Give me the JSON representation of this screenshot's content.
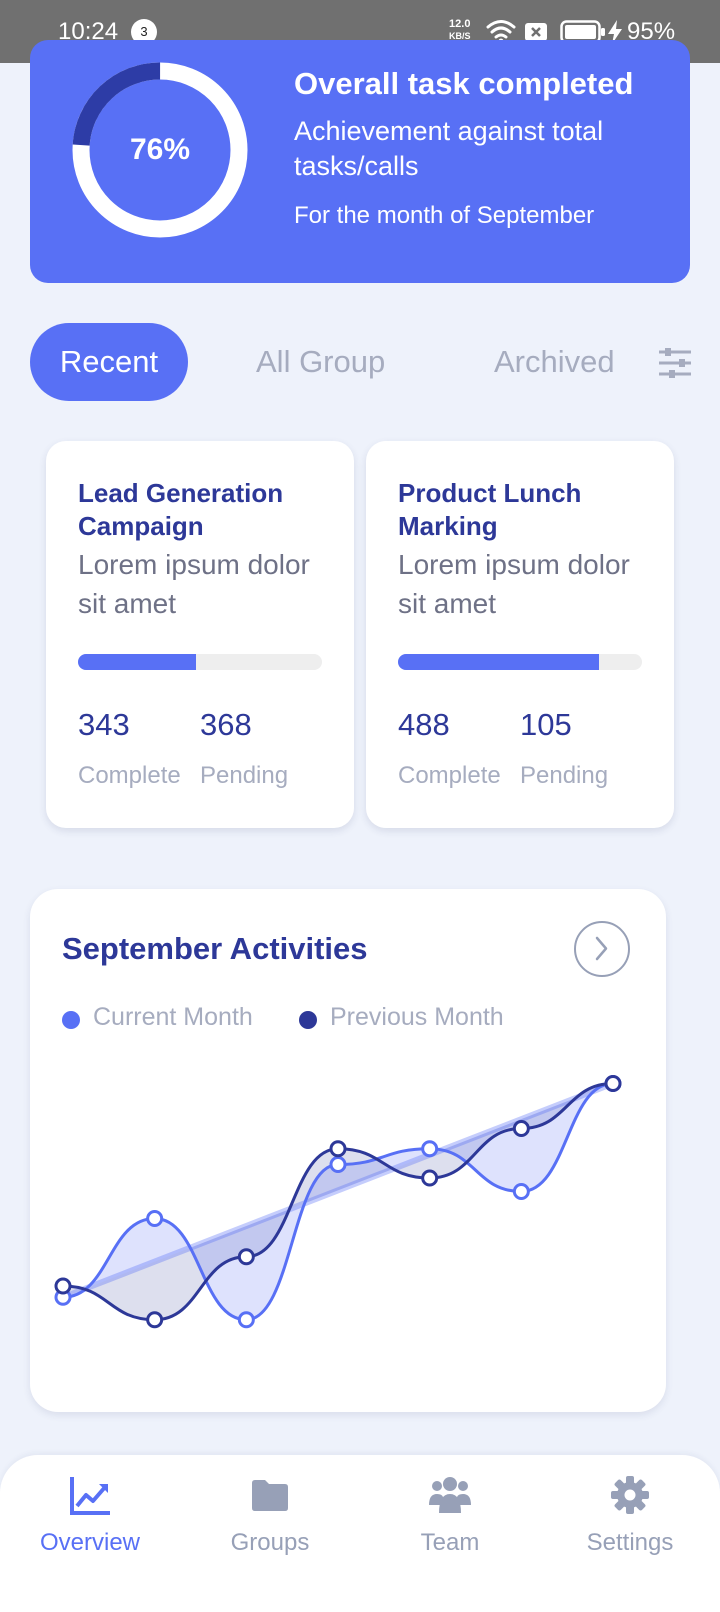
{
  "status_bar": {
    "time": "10:24",
    "notification_count": "3",
    "net_speed_value": "12.0",
    "net_speed_unit": "KB/S",
    "battery": "95%"
  },
  "summary": {
    "percent": "76%",
    "percent_value": 76,
    "title": "Overall task completed",
    "subtitle": "Achievement against total tasks/calls",
    "period": "For the month of September"
  },
  "tabs": {
    "recent": "Recent",
    "all_group": "All Group",
    "archived": "Archived"
  },
  "campaigns": [
    {
      "title": "Lead Generation Campaign",
      "description": "Lorem ipsum dolor sit amet",
      "progress": 0.485,
      "complete_value": "343",
      "pending_value": "368",
      "complete_label": "Complete",
      "pending_label": "Pending"
    },
    {
      "title": "Product Lunch Marking",
      "description": "Lorem ipsum dolor sit amet",
      "progress": 0.823,
      "complete_value": "488",
      "pending_value": "105",
      "complete_label": "Complete",
      "pending_label": "Pending"
    }
  ],
  "activities": {
    "title": "September Activities",
    "legend_current": "Current Month",
    "legend_previous": "Previous Month"
  },
  "colors": {
    "accent": "#5870f5",
    "navy": "#2d3898",
    "muted": "#a6acbf",
    "background": "#eef2fb"
  },
  "chart_data": {
    "type": "line",
    "x": [
      1,
      2,
      3,
      4,
      5,
      6,
      7
    ],
    "series": [
      {
        "name": "Current Month",
        "values": [
          0.5,
          4.0,
          -0.5,
          6.4,
          7.1,
          5.2,
          10
        ]
      },
      {
        "name": "Previous Month",
        "values": [
          1.0,
          -0.5,
          2.3,
          7.1,
          5.8,
          8.0,
          10
        ]
      }
    ],
    "ylim": [
      -1,
      11
    ],
    "grid": false
  },
  "bottom_nav": [
    {
      "label": "Overview",
      "icon": "chart-line-icon",
      "active": true
    },
    {
      "label": "Groups",
      "icon": "folder-icon",
      "active": false
    },
    {
      "label": "Team",
      "icon": "team-icon",
      "active": false
    },
    {
      "label": "Settings",
      "icon": "gear-icon",
      "active": false
    }
  ]
}
